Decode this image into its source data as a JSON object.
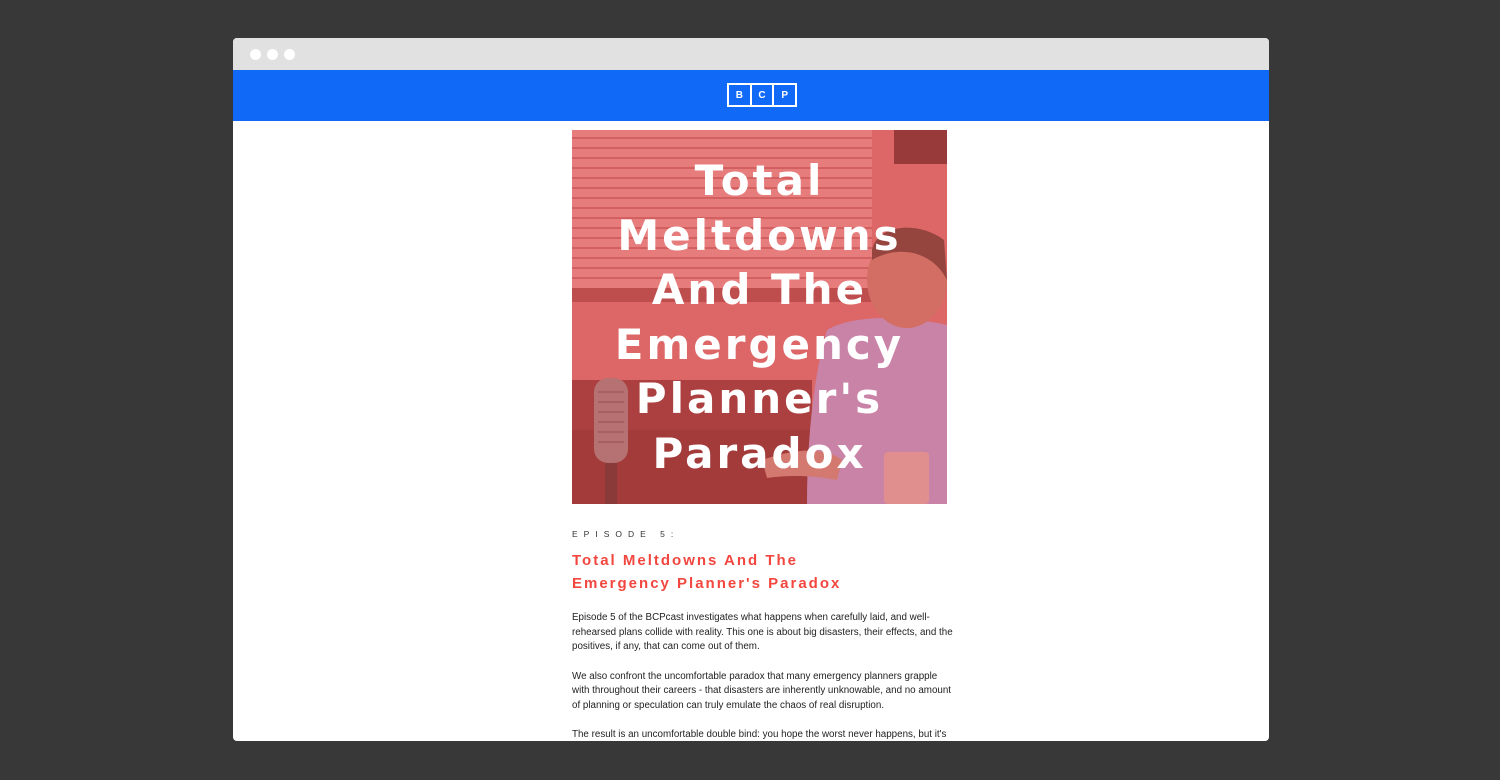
{
  "window": {
    "dots": [
      "close",
      "minimize",
      "maximize"
    ]
  },
  "header": {
    "logo_letters": [
      "B",
      "C",
      "P"
    ],
    "background": "#1169f7"
  },
  "hero": {
    "title": "Total Meltdowns And The Emergency Planner's Paradox",
    "overlay_color": "#e85858"
  },
  "article": {
    "eyebrow": "EPISODE 5:",
    "headline_line1": "Total Meltdowns And The",
    "headline_line2": "Emergency Planner's Paradox",
    "headline_color": "#f2463f",
    "paragraphs": [
      "Episode 5 of the BCPcast investigates what happens when carefully laid, and well-rehearsed plans collide with reality. This one is about big disasters, their effects, and the positives, if any, that can come out of them.",
      "We also confront the uncomfortable paradox that many emergency planners grapple with throughout their careers - that disasters are inherently unknowable, and no amount of planning or speculation can truly emulate the chaos of real disruption.",
      "The result is an uncomfortable double bind: you hope the worst never happens, but it's the only time your plans truly get tested."
    ]
  }
}
